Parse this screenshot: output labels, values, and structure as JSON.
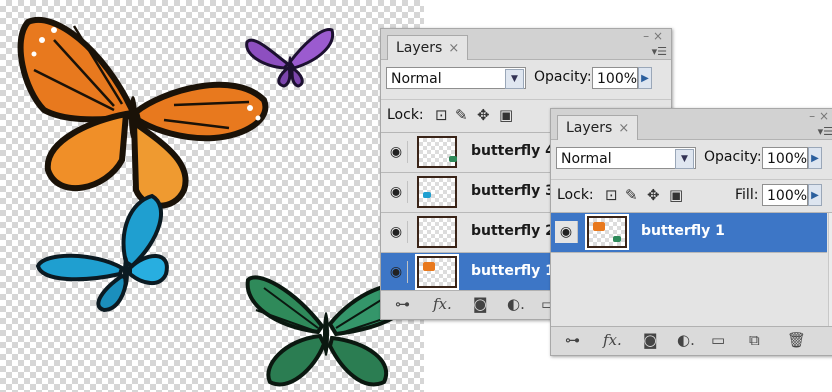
{
  "colors": {
    "orange_wing": "#e8791e",
    "blue_wing": "#1f9fd0",
    "green_wing": "#2f8a5a",
    "purple_wing": "#8d4fc0",
    "selection": "#3d76c6"
  },
  "panel_back": {
    "tab_label": "Layers",
    "tab_close": "×",
    "blend_mode": "Normal",
    "opacity_label": "Opacity:",
    "opacity_value": "100%",
    "lock_label": "Lock:",
    "layers": [
      {
        "name": "butterfly 4",
        "selected": false
      },
      {
        "name": "butterfly 3",
        "selected": false
      },
      {
        "name": "butterfly 2",
        "selected": false
      },
      {
        "name": "butterfly 1",
        "selected": true
      }
    ]
  },
  "panel_front": {
    "tab_label": "Layers",
    "tab_close": "×",
    "blend_mode": "Normal",
    "opacity_label": "Opacity:",
    "opacity_value": "100%",
    "lock_label": "Lock:",
    "fill_label": "Fill:",
    "fill_value": "100%",
    "layers": [
      {
        "name": "butterfly 1",
        "selected": true
      }
    ]
  },
  "icons": {
    "eye": "eye-icon",
    "link": "link-icon",
    "fx": "fx-icon",
    "mask": "mask-icon",
    "adjustment": "adjustment-layer-icon",
    "folder": "folder-icon",
    "new_layer": "new-layer-icon",
    "trash": "trash-icon"
  }
}
